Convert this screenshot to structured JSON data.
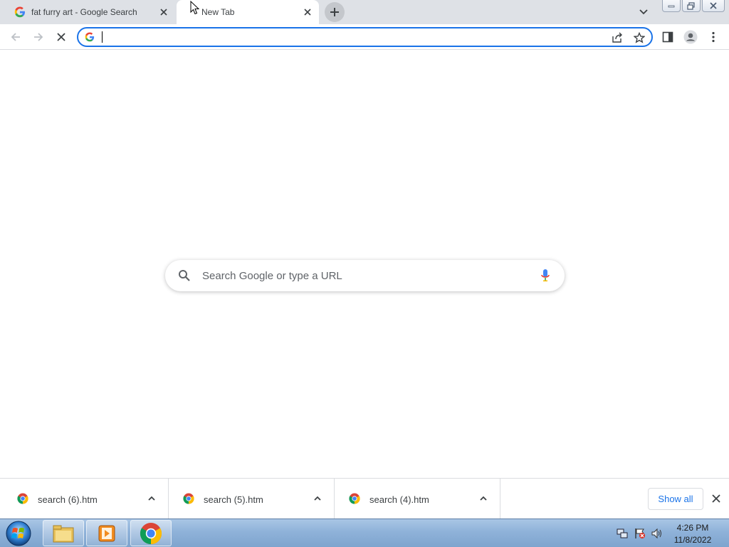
{
  "browser": {
    "tabs": [
      {
        "title": "fat furry art - Google Search",
        "active": false,
        "favicon": "google-g-icon"
      },
      {
        "title": "New Tab",
        "active": true,
        "favicon": "none"
      }
    ],
    "omnibox": {
      "value": "",
      "placeholder": ""
    },
    "colors": {
      "accent": "#1a73e8",
      "tabstrip": "#dee1e6"
    }
  },
  "ntp": {
    "search_placeholder": "Search Google or type a URL"
  },
  "downloads": {
    "items": [
      {
        "name": "search (6).htm",
        "icon": "chrome-icon"
      },
      {
        "name": "search (5).htm",
        "icon": "chrome-icon"
      },
      {
        "name": "search (4).htm",
        "icon": "chrome-icon"
      }
    ],
    "show_all_label": "Show all"
  },
  "taskbar": {
    "items": [
      "start-orb",
      "file-explorer-icon",
      "media-player-icon",
      "chrome-icon"
    ],
    "clock": {
      "time": "4:26 PM",
      "date": "11/8/2022"
    }
  }
}
